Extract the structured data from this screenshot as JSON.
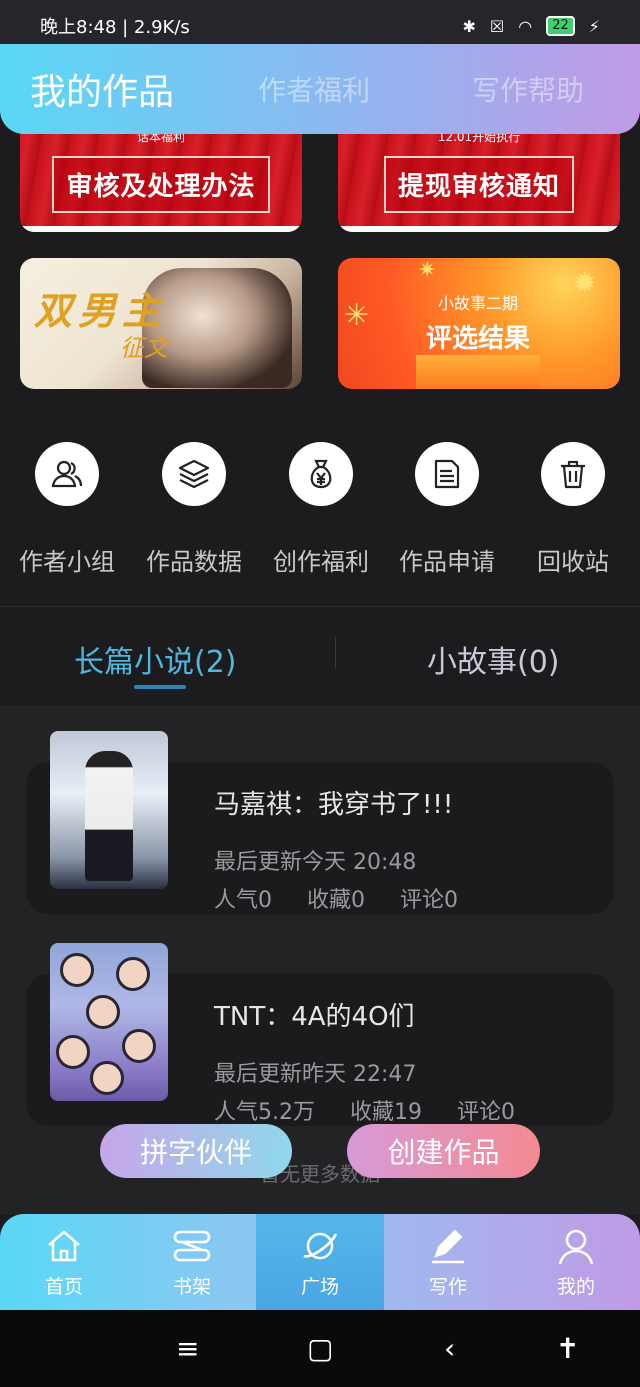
{
  "status_bar": {
    "time_speed": "晚上8:48 | 2.9K/s",
    "battery": "22"
  },
  "top_tabs": [
    "我的作品",
    "作者福利",
    "写作帮助"
  ],
  "banners": {
    "b1": {
      "topline": "话本福利",
      "title": "审核及处理办法"
    },
    "b2": {
      "topline": "12.01开始执行",
      "title": "提现审核通知"
    },
    "b3": {
      "title": "双男主",
      "subtitle": "征文"
    },
    "b4": {
      "small": "小故事二期",
      "big": "评选结果"
    }
  },
  "quick_icons": [
    {
      "label": "作者小组",
      "icon": "users-icon"
    },
    {
      "label": "作品数据",
      "icon": "layers-icon"
    },
    {
      "label": "创作福利",
      "icon": "money-bag-icon"
    },
    {
      "label": "作品申请",
      "icon": "document-icon"
    },
    {
      "label": "回收站",
      "icon": "trash-icon"
    }
  ],
  "segments": {
    "novel": "长篇小说(2)",
    "story": "小故事(0)"
  },
  "works": [
    {
      "title": "马嘉祺：我穿书了!!!",
      "updated": "最后更新今天 20:48",
      "popularity": "人气0",
      "favorites": "收藏0",
      "comments": "评论0"
    },
    {
      "title": "TNT：4A的4O们",
      "updated": "最后更新昨天 22:47",
      "popularity": "人气5.2万",
      "favorites": "收藏19",
      "comments": "评论0"
    }
  ],
  "loading": "暂无更多数据",
  "pills": {
    "partner": "拼字伙伴",
    "create": "创建作品"
  },
  "bottom_nav": [
    "首页",
    "书架",
    "广场",
    "写作",
    "我的"
  ],
  "colors": {
    "accent": "#4fb6de",
    "gradient_start": "#5ad8f6",
    "gradient_end": "#c09ae6"
  }
}
